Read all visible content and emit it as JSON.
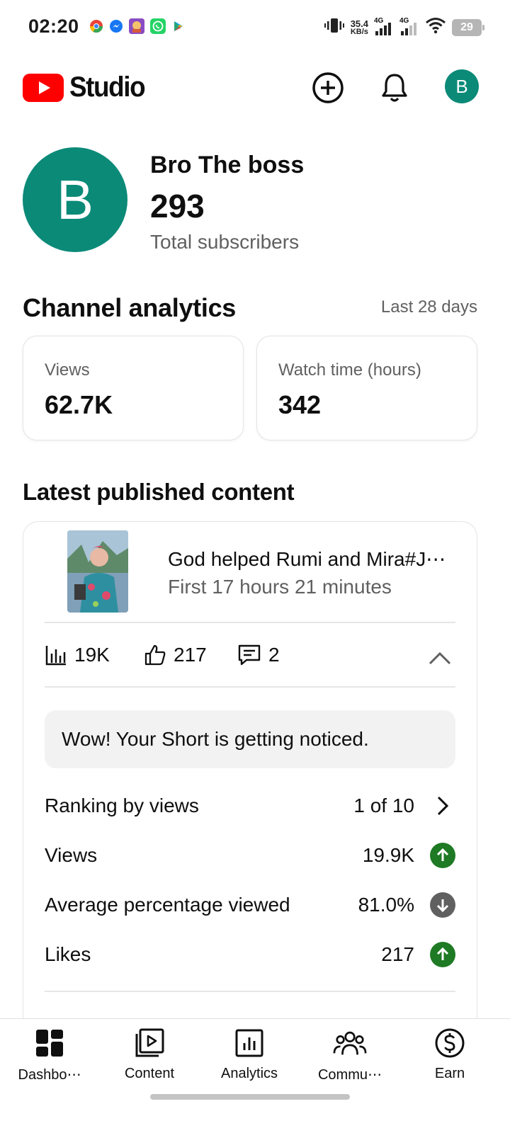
{
  "status_bar": {
    "time": "02:20",
    "net_speed_value": "35.4",
    "net_speed_unit": "KB/s",
    "network_1": "4G",
    "network_2": "4G",
    "battery": "29",
    "app_icons": [
      "chrome-icon",
      "messenger-icon",
      "game-icon",
      "whatsapp-icon",
      "play-store-icon"
    ]
  },
  "header": {
    "logo_text": "Studio",
    "avatar_letter": "B",
    "icons": [
      "create-icon",
      "notifications-icon"
    ]
  },
  "channel": {
    "avatar_letter": "B",
    "name": "Bro The boss",
    "subscriber_count": "293",
    "subscriber_label": "Total subscribers"
  },
  "analytics": {
    "title": "Channel analytics",
    "period": "Last 28 days",
    "cards": [
      {
        "label": "Views",
        "value": "62.7K"
      },
      {
        "label": "Watch time (hours)",
        "value": "342"
      }
    ]
  },
  "latest": {
    "title": "Latest published content",
    "video_title": "God helped Rumi and Mira#J⋯",
    "video_age": "First 17 hours 21 minutes",
    "metrics": {
      "views": "19K",
      "likes": "217",
      "comments": "2"
    },
    "notice": "Wow! Your Short is getting noticed.",
    "rows": [
      {
        "label": "Ranking by views",
        "value": "1 of 10",
        "indicator": "chevron-right"
      },
      {
        "label": "Views",
        "value": "19.9K",
        "indicator": "up"
      },
      {
        "label": "Average percentage viewed",
        "value": "81.0%",
        "indicator": "down"
      },
      {
        "label": "Likes",
        "value": "217",
        "indicator": "up"
      }
    ],
    "colors": {
      "up": "#1e7a24",
      "down": "#606060"
    }
  },
  "bottom_nav": [
    {
      "label": "Dashbo⋯",
      "icon": "dashboard-icon"
    },
    {
      "label": "Content",
      "icon": "content-icon"
    },
    {
      "label": "Analytics",
      "icon": "analytics-icon"
    },
    {
      "label": "Commu⋯",
      "icon": "community-icon"
    },
    {
      "label": "Earn",
      "icon": "earn-icon"
    }
  ],
  "colors": {
    "brand_red": "#ff0000",
    "avatar_teal": "#0b8a78"
  }
}
